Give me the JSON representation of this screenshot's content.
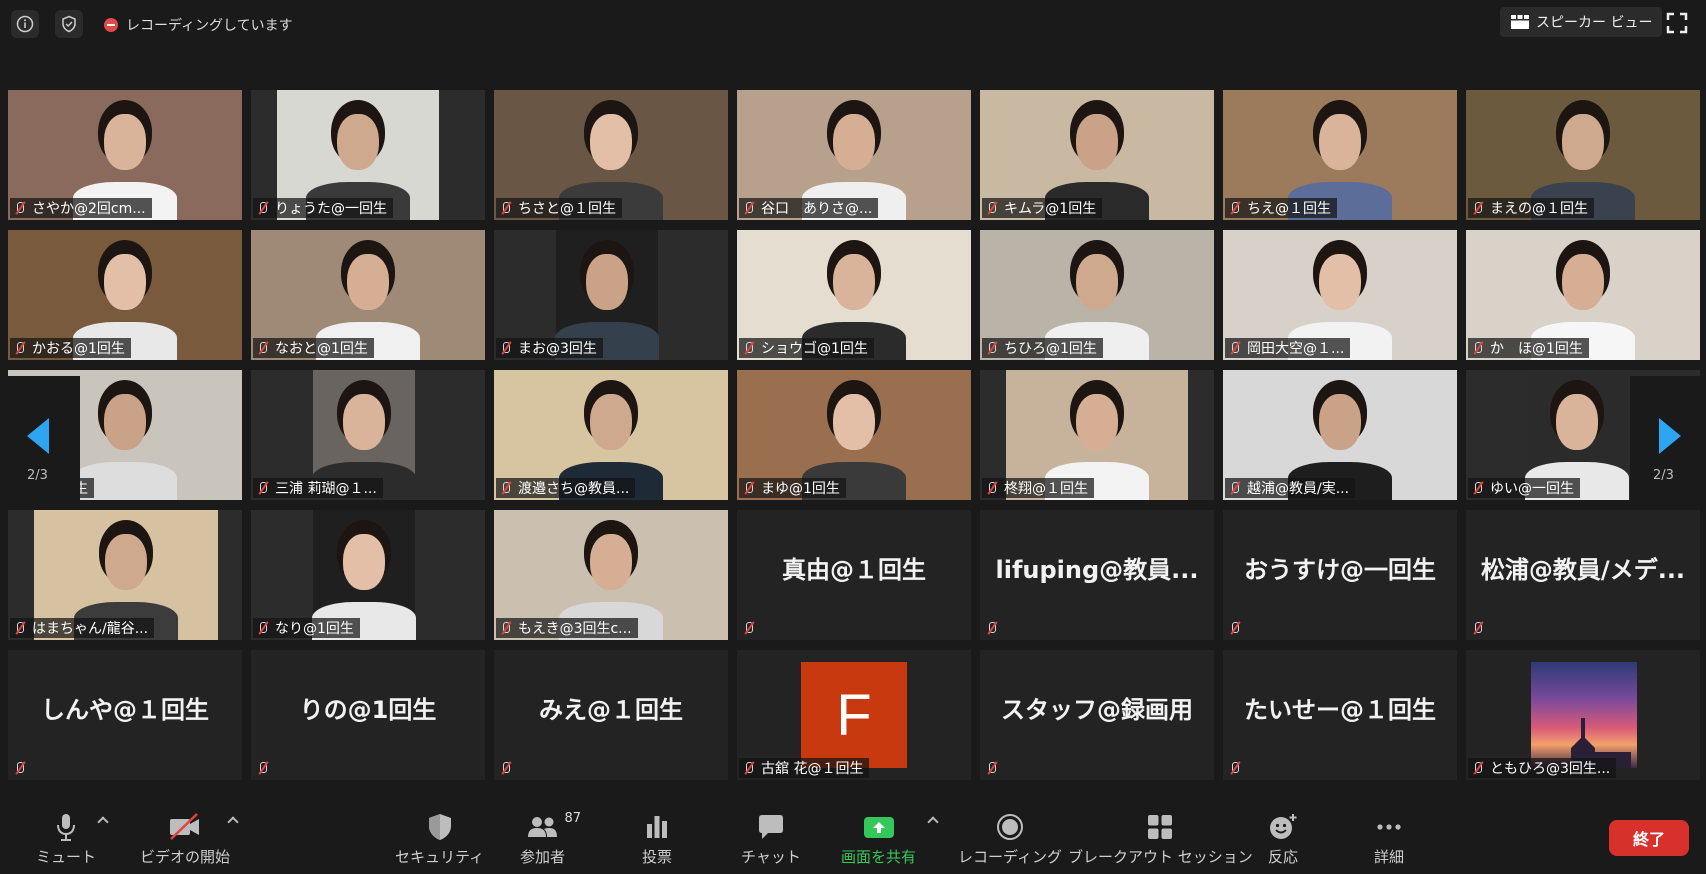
{
  "top": {
    "recording_status": "レコーディングしています",
    "view_toggle": "スピーカー ビュー"
  },
  "video_tiles": [
    {
      "name": "さやか@2回cm..."
    },
    {
      "name": "りょうた@一回生"
    },
    {
      "name": "ちさと@１回生"
    },
    {
      "name": "谷口　ありさ@..."
    },
    {
      "name": "キムラ@1回生"
    },
    {
      "name": "ちえ@１回生"
    },
    {
      "name": "まえの@１回生"
    },
    {
      "name": "かおる@1回生"
    },
    {
      "name": "なおと@1回生"
    },
    {
      "name": "まお@3回生"
    },
    {
      "name": "ショウゴ@1回生"
    },
    {
      "name": "ちひろ@1回生"
    },
    {
      "name": "岡田大空@１..."
    },
    {
      "name": "か　ほ@1回生"
    },
    {
      "name": "@１回生"
    },
    {
      "name": "三浦 莉瑚@１..."
    },
    {
      "name": "渡邉さち@教員..."
    },
    {
      "name": "まゆ@1回生"
    },
    {
      "name": "柊翔@１回生"
    },
    {
      "name": "越浦@教員/実..."
    },
    {
      "name": "ゆい@一回生"
    },
    {
      "name": "はまちゃん/龍谷..."
    },
    {
      "name": "なり@1回生"
    },
    {
      "name": "もえき@3回生c..."
    }
  ],
  "name_tiles": [
    {
      "display": "真由@１回生"
    },
    {
      "display": "lifuping@教員..."
    },
    {
      "display": "おうすけ@一回生"
    },
    {
      "display": "松浦@教員/メデ..."
    },
    {
      "display": "しんや@１回生"
    },
    {
      "display": "りの@1回生"
    },
    {
      "display": "みえ@１回生"
    },
    {
      "display": "スタッフ@録画用"
    },
    {
      "display": "たいせー@１回生"
    }
  ],
  "avatar_tiles": [
    {
      "name": "古舘 花@１回生",
      "letter": "F",
      "color": "#c8390f"
    },
    {
      "name": "ともひろ@3回生..."
    }
  ],
  "pagination": {
    "left": "2/3",
    "right": "2/3"
  },
  "toolbar": {
    "mute": "ミュート",
    "start_video": "ビデオの開始",
    "security": "セキュリティ",
    "participants": "参加者",
    "participants_count": "87",
    "polls": "投票",
    "chat": "チャット",
    "share_screen": "画面を共有",
    "recording": "レコーディング",
    "breakout": "ブレークアウト セッション",
    "reactions": "反応",
    "more": "詳細",
    "end": "終了"
  },
  "colors": {
    "accent_blue": "#2ea5f0",
    "share_green": "#34c759",
    "end_red": "#d8312b",
    "muted_red": "#e0443e"
  }
}
